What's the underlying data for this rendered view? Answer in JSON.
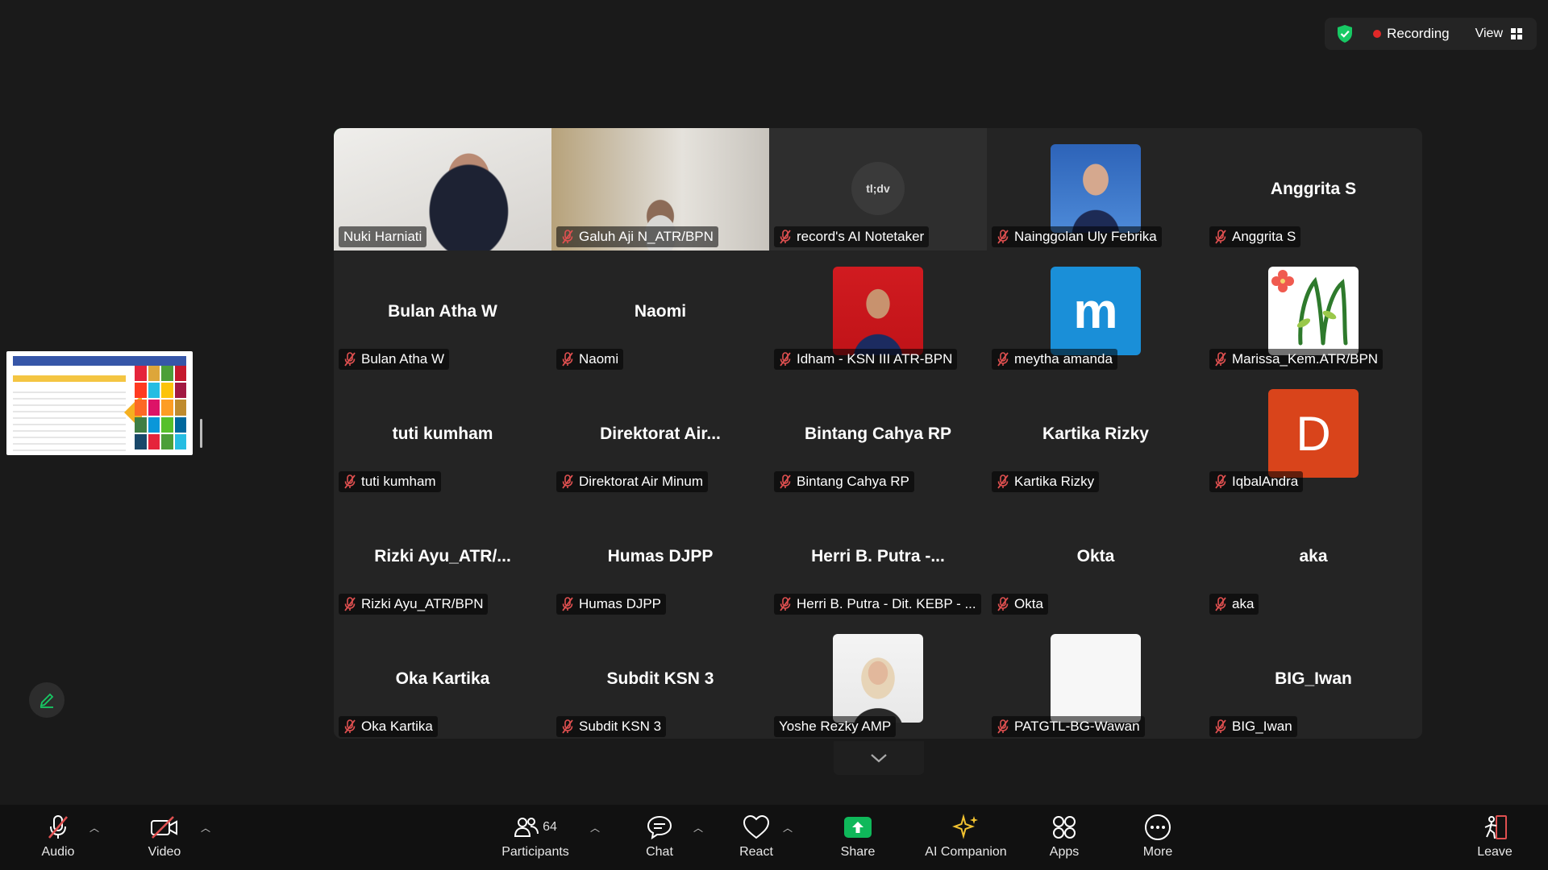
{
  "status": {
    "recording_label": "Recording",
    "view_label": "View"
  },
  "colors": {
    "accent_green": "#17c964",
    "record_red": "#e02828",
    "share_green": "#0fb85a",
    "muted_red": "#e05050",
    "avatar_blue": "#1a8fd8",
    "avatar_orange": "#d9441b"
  },
  "notetaker_logo_text": "tl;dv",
  "tiles": [
    {
      "name": "Nuki Harniati",
      "center": "",
      "kind": "video",
      "muted": false,
      "active": true
    },
    {
      "name": "Galuh Aji N_ATR/BPN",
      "center": "",
      "kind": "video",
      "muted": true
    },
    {
      "name": "record's AI Notetaker",
      "center": "",
      "kind": "notetaker",
      "muted": true
    },
    {
      "name": "Nainggolan Uly Febrika",
      "center": "",
      "kind": "photo-blue",
      "muted": true
    },
    {
      "name": "Anggrita S",
      "center": "Anggrita S",
      "kind": "name",
      "muted": true
    },
    {
      "name": "Bulan Atha W",
      "center": "Bulan Atha W",
      "kind": "name",
      "muted": true
    },
    {
      "name": "Naomi",
      "center": "Naomi",
      "kind": "name",
      "muted": true
    },
    {
      "name": "Idham - KSN III ATR-BPN",
      "center": "",
      "kind": "photo-red",
      "muted": true
    },
    {
      "name": "meytha amanda",
      "center": "",
      "kind": "letter-blue",
      "letter": "m",
      "muted": true
    },
    {
      "name": "Marissa_Kem.ATR/BPN",
      "center": "",
      "kind": "flower",
      "muted": true
    },
    {
      "name": "tuti kumham",
      "center": "tuti kumham",
      "kind": "name",
      "muted": true
    },
    {
      "name": "Direktorat Air Minum",
      "center": "Direktorat  Air...",
      "kind": "name",
      "muted": true
    },
    {
      "name": "Bintang Cahya RP",
      "center": "Bintang Cahya RP",
      "kind": "name",
      "muted": true
    },
    {
      "name": "Kartika Rizky",
      "center": "Kartika Rizky",
      "kind": "name",
      "muted": true
    },
    {
      "name": "IqbalAndra",
      "center": "",
      "kind": "letter-orange",
      "letter": "D",
      "muted": true
    },
    {
      "name": "Rizki Ayu_ATR/BPN",
      "center": "Rizki  Ayu_ATR/...",
      "kind": "name",
      "muted": true
    },
    {
      "name": "Humas DJPP",
      "center": "Humas DJPP",
      "kind": "name",
      "muted": true
    },
    {
      "name": "Herri B. Putra - Dit. KEBP - ...",
      "center": "Herri  B.  Putra  -...",
      "kind": "name",
      "muted": true
    },
    {
      "name": "Okta",
      "center": "Okta",
      "kind": "name",
      "muted": true
    },
    {
      "name": "aka",
      "center": "aka",
      "kind": "name",
      "muted": true
    },
    {
      "name": "Oka Kartika",
      "center": "Oka Kartika",
      "kind": "name",
      "muted": true
    },
    {
      "name": "Subdit KSN 3",
      "center": "Subdit KSN 3",
      "kind": "name",
      "muted": true
    },
    {
      "name": "Yoshe Rezky AMP",
      "center": "",
      "kind": "photo-hijab",
      "muted": false
    },
    {
      "name": "PATGTL-BG-Wawan",
      "center": "",
      "kind": "photo-white",
      "muted": true
    },
    {
      "name": "BIG_Iwan",
      "center": "BIG_Iwan",
      "kind": "name",
      "muted": true
    }
  ],
  "toolbar": {
    "audio": "Audio",
    "video": "Video",
    "participants": "Participants",
    "participants_count": "64",
    "chat": "Chat",
    "react": "React",
    "share": "Share",
    "ai_companion": "AI Companion",
    "apps": "Apps",
    "more": "More",
    "leave": "Leave"
  }
}
